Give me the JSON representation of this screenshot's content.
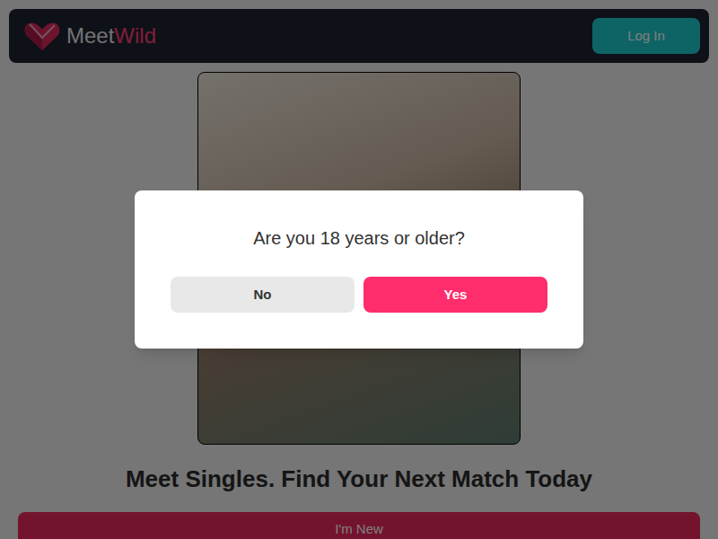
{
  "header": {
    "logo": {
      "first": "Meet",
      "second": "Wild"
    },
    "login_button": "Log In"
  },
  "hero": {
    "heading": "Meet Singles. Find Your Next Match Today",
    "cta_button": "I'm New"
  },
  "modal": {
    "question": "Are you 18 years or older?",
    "buttons": [
      {
        "label": "No",
        "kind": "secondary"
      },
      {
        "label": "Yes",
        "kind": "primary"
      }
    ]
  }
}
